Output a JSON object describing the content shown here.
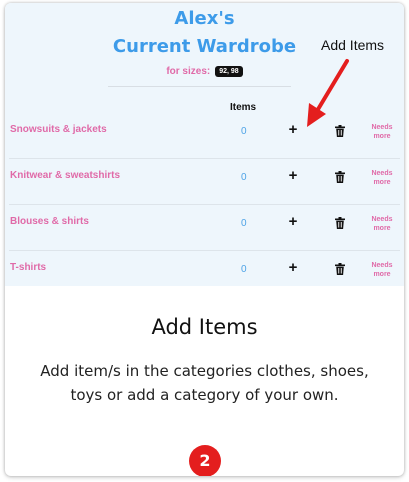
{
  "header": {
    "title_line1": "Alex's",
    "title_line2": "Current Wardrobe",
    "sizes_label": "for sizes:",
    "sizes_value": "92, 98",
    "items_column": "Items"
  },
  "rows": [
    {
      "category": "Snowsuits & jackets",
      "count": "0",
      "add": "+",
      "needs_line1": "Needs",
      "needs_line2": "more"
    },
    {
      "category": "Knitwear & sweatshirts",
      "count": "0",
      "add": "+",
      "needs_line1": "Needs",
      "needs_line2": "more"
    },
    {
      "category": "Blouses & shirts",
      "count": "0",
      "add": "+",
      "needs_line1": "Needs",
      "needs_line2": "more"
    },
    {
      "category": "T-shirts",
      "count": "0",
      "add": "+",
      "needs_line1": "Needs",
      "needs_line2": "more"
    }
  ],
  "annotation": {
    "label": "Add Items"
  },
  "info": {
    "title": "Add Items",
    "body": "Add item/s in the categories clothes, shoes, toys or add a category of your own."
  },
  "step_badge": "2",
  "colors": {
    "title_blue": "#3d9be9",
    "pink": "#e06aa8",
    "arrow_red": "#e41e1e",
    "panel_bg": "#eef6fc"
  }
}
